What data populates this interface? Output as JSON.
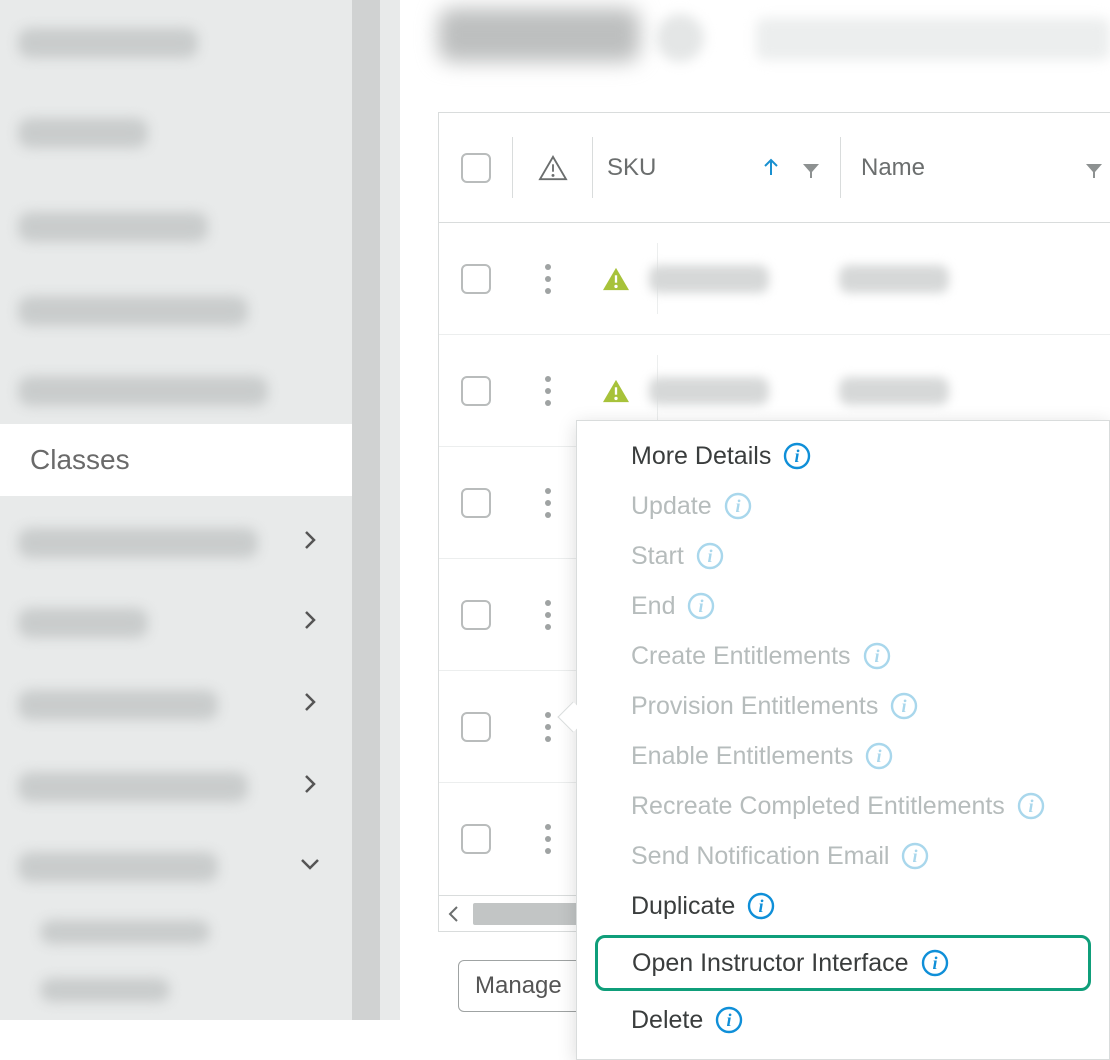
{
  "page": {
    "title": "Classes"
  },
  "sidebar": {
    "active_label": "Classes"
  },
  "table": {
    "columns": {
      "sku": "SKU",
      "name": "Name"
    },
    "rows": [
      {
        "status": "warn"
      },
      {
        "status": "warn"
      },
      {
        "status": "none"
      },
      {
        "status": "none"
      },
      {
        "status": "none"
      },
      {
        "status": "none"
      }
    ]
  },
  "buttons": {
    "manage_prefix": "Manage "
  },
  "context_menu": {
    "items": [
      {
        "label": "More Details",
        "enabled": true,
        "highlight": false
      },
      {
        "label": "Update",
        "enabled": false,
        "highlight": false
      },
      {
        "label": "Start",
        "enabled": false,
        "highlight": false
      },
      {
        "label": "End",
        "enabled": false,
        "highlight": false
      },
      {
        "label": "Create Entitlements",
        "enabled": false,
        "highlight": false
      },
      {
        "label": "Provision Entitlements",
        "enabled": false,
        "highlight": false
      },
      {
        "label": "Enable Entitlements",
        "enabled": false,
        "highlight": false
      },
      {
        "label": "Recreate Completed Entitlements",
        "enabled": false,
        "highlight": false
      },
      {
        "label": "Send Notification Email",
        "enabled": false,
        "highlight": false
      },
      {
        "label": "Duplicate",
        "enabled": true,
        "highlight": false
      },
      {
        "label": "Open Instructor Interface",
        "enabled": true,
        "highlight": true
      },
      {
        "label": "Delete",
        "enabled": true,
        "highlight": false
      }
    ]
  }
}
